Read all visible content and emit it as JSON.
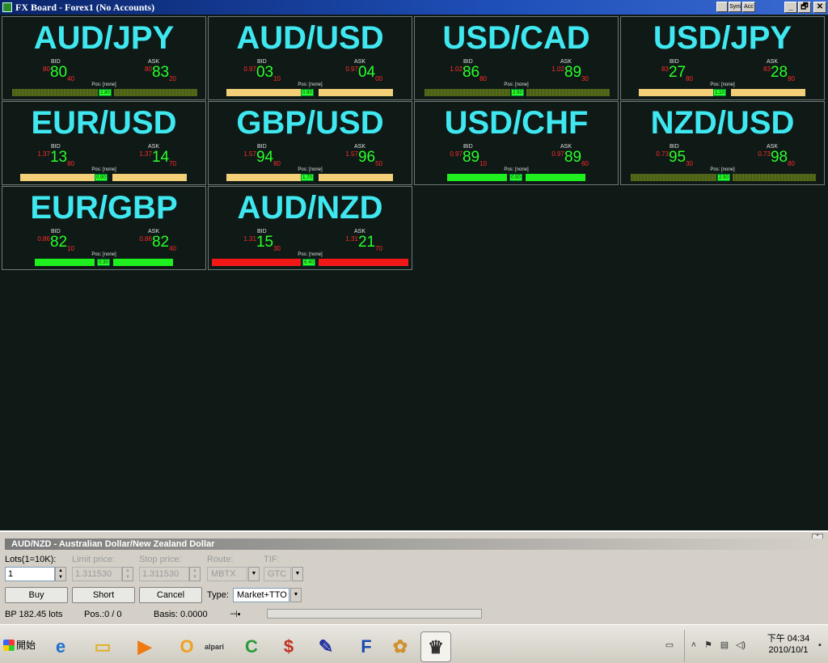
{
  "window": {
    "title": "FX Board - Forex1 (No Accounts)",
    "mini_buttons": [
      "Sym",
      "Acc"
    ],
    "controls": [
      "_",
      "🗗",
      "✕"
    ]
  },
  "tiles": [
    {
      "pair": "AUD/JPY",
      "bid_label": "BID",
      "ask_label": "ASK",
      "bid_pre": "80",
      "bid_big": "80",
      "bid_sub": "40",
      "ask_pre": "80",
      "ask_big": "83",
      "ask_sub": "20",
      "pos": "Pos: [none]",
      "spread": "2.80",
      "bar_color": "olive"
    },
    {
      "pair": "AUD/USD",
      "bid_label": "BID",
      "ask_label": "ASK",
      "bid_pre": "0.97",
      "bid_big": "03",
      "bid_sub": "10",
      "ask_pre": "0.97",
      "ask_big": "04",
      "ask_sub": "00",
      "pos": "Pos: [none]",
      "spread": "0.90",
      "bar_color": "tan"
    },
    {
      "pair": "USD/CAD",
      "bid_label": "BID",
      "ask_label": "ASK",
      "bid_pre": "1.02",
      "bid_big": "86",
      "bid_sub": "80",
      "ask_pre": "1.02",
      "ask_big": "89",
      "ask_sub": "30",
      "pos": "Pos: [none]",
      "spread": "2.50",
      "bar_color": "olive"
    },
    {
      "pair": "USD/JPY",
      "bid_label": "BID",
      "ask_label": "ASK",
      "bid_pre": "83",
      "bid_big": "27",
      "bid_sub": "80",
      "ask_pre": "83",
      "ask_big": "28",
      "ask_sub": "90",
      "pos": "Pos: [none]",
      "spread": "1.10",
      "bar_color": "tan"
    },
    {
      "pair": "EUR/USD",
      "bid_label": "BID",
      "ask_label": "ASK",
      "bid_pre": "1.37",
      "bid_big": "13",
      "bid_sub": "80",
      "ask_pre": "1.37",
      "ask_big": "14",
      "ask_sub": "70",
      "pos": "Pos: [none]",
      "spread": "0.90",
      "bar_color": "tan"
    },
    {
      "pair": "GBP/USD",
      "bid_label": "BID",
      "ask_label": "ASK",
      "bid_pre": "1.57",
      "bid_big": "94",
      "bid_sub": "80",
      "ask_pre": "1.57",
      "ask_big": "96",
      "ask_sub": "50",
      "pos": "Pos: [none]",
      "spread": "1.70",
      "bar_color": "tan"
    },
    {
      "pair": "USD/CHF",
      "bid_label": "BID",
      "ask_label": "ASK",
      "bid_pre": "0.97",
      "bid_big": "89",
      "bid_sub": "10",
      "ask_pre": "0.97",
      "ask_big": "89",
      "ask_sub": "60",
      "pos": "Pos: [none]",
      "spread": "0.50",
      "bar_color": "green"
    },
    {
      "pair": "NZD/USD",
      "bid_label": "BID",
      "ask_label": "ASK",
      "bid_pre": "0.73",
      "bid_big": "95",
      "bid_sub": "30",
      "ask_pre": "0.73",
      "ask_big": "98",
      "ask_sub": "80",
      "pos": "Pos: [none]",
      "spread": "2.50",
      "bar_color": "olive"
    },
    {
      "pair": "EUR/GBP",
      "bid_label": "BID",
      "ask_label": "ASK",
      "bid_pre": "0.86",
      "bid_big": "82",
      "bid_sub": "10",
      "ask_pre": "0.86",
      "ask_big": "82",
      "ask_sub": "40",
      "pos": "Pos: [none]",
      "spread": "0.30",
      "bar_color": "green"
    },
    {
      "pair": "AUD/NZD",
      "bid_label": "BID",
      "ask_label": "ASK",
      "bid_pre": "1.31",
      "bid_big": "15",
      "bid_sub": "30",
      "ask_pre": "1.31",
      "ask_big": "21",
      "ask_sub": "70",
      "pos": "Pos: [none]",
      "spread": "6.40",
      "bar_color": "red"
    }
  ],
  "order": {
    "header": "AUD/NZD - Australian Dollar/New Zealand Dollar",
    "lots_label": "Lots(1=10K):",
    "lots_value": "1",
    "limit_label": "Limit price:",
    "limit_value": "1.311530",
    "stop_label": "Stop price:",
    "stop_value": "1.311530",
    "route_label": "Route:",
    "route_value": "MBTX",
    "tif_label": "TIF:",
    "tif_value": "GTC",
    "buy": "Buy",
    "short": "Short",
    "cancel": "Cancel",
    "type_label": "Type:",
    "type_value": "Market+TTO",
    "bp": "BP 182.45 lots",
    "pos": "Pos.:0 / 0",
    "basis": "Basis: 0.0000"
  },
  "taskbar": {
    "start_label": "開始",
    "quicklaunch": [
      {
        "name": "internet-explorer-icon",
        "glyph": "e",
        "color": "#1e6fd0"
      },
      {
        "name": "folder-icon",
        "glyph": "▭",
        "color": "#e0b030"
      },
      {
        "name": "media-player-icon",
        "glyph": "▶",
        "color": "#f07a10"
      },
      {
        "name": "outlook-icon",
        "glyph": "O",
        "color": "#f0a020"
      },
      {
        "name": "alpari-icon",
        "glyph": "alpari",
        "color": "#3a7a9a"
      },
      {
        "name": "ccleaner-icon",
        "glyph": "C",
        "color": "#2a9a3a"
      },
      {
        "name": "calculator-app-icon",
        "glyph": "$",
        "color": "#c03020"
      },
      {
        "name": "paint-tool-icon",
        "glyph": "✎",
        "color": "#2030a0"
      },
      {
        "name": "f-app-icon",
        "glyph": "F",
        "color": "#1a4ab0"
      },
      {
        "name": "palette-icon",
        "glyph": "✿",
        "color": "#d09030"
      },
      {
        "name": "trading-app-icon",
        "glyph": "♛",
        "color": "#303030"
      }
    ],
    "clock_time": "下午 04:34",
    "clock_date": "2010/10/1"
  }
}
